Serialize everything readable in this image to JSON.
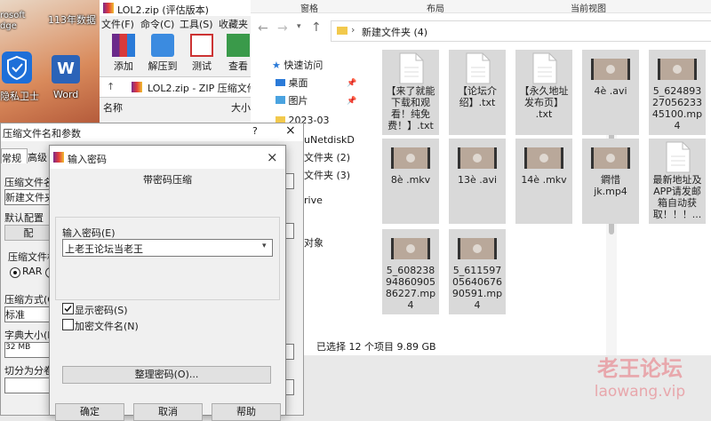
{
  "desktop": {
    "icons": [
      {
        "label": "rosoft\ndge"
      },
      {
        "label": "隐私卫士"
      },
      {
        "label": "Word"
      }
    ],
    "folder_label": "113年数据"
  },
  "zip_window": {
    "title": "LOL2.zip (评估版本)",
    "menu": [
      "文件(F)",
      "命令(C)",
      "工具(S)",
      "收藏夹"
    ],
    "tools": [
      {
        "label": "添加",
        "icon": "add-archive-icon"
      },
      {
        "label": "解压到",
        "icon": "extract-folder-icon"
      },
      {
        "label": "测试",
        "icon": "test-clipboard-icon"
      },
      {
        "label": "查看",
        "icon": "view-book-icon"
      }
    ],
    "path": "LOL2.zip - ZIP 压缩文件,",
    "columns": [
      "名称",
      "大小"
    ]
  },
  "archive_dialog": {
    "title": "压缩文件名和参数",
    "title_help": "?",
    "close": "×",
    "tabs": [
      "常规",
      "高级"
    ],
    "labels": {
      "archive_name": "压缩文件名",
      "archive_name_value": "新建文件夹",
      "default_config": "默认配置",
      "default_btn": "配",
      "format": "压缩文件格",
      "format_rar": "RAR",
      "method": "压缩方式(C",
      "method_value": "标准",
      "dict": "字典大小(I",
      "dict_value": "32 MB",
      "split": "切分为分卷"
    }
  },
  "password_dialog": {
    "title": "输入密码",
    "close": "×",
    "heading": "带密码压缩",
    "input_label": "输入密码(E)",
    "password_value": "上老王论坛当老王",
    "show_password": {
      "label": "显示密码(S)",
      "checked": true
    },
    "encrypt_names": {
      "label": "加密文件名(N)",
      "checked": false
    },
    "organize_button": "整理密码(O)...",
    "buttons": {
      "ok": "确定",
      "cancel": "取消",
      "help": "帮助"
    }
  },
  "explorer": {
    "ribbon": [
      "窗格",
      "布局",
      "当前视图"
    ],
    "breadcrumb": "新建文件夹 (4)",
    "nav": [
      {
        "label": "快速访问",
        "pinned": false
      },
      {
        "label": "桌面",
        "pinned": true
      },
      {
        "label": "图片",
        "pinned": true
      },
      {
        "label": "2023-03",
        "pinned": false
      },
      {
        "label": "uNetdiskD",
        "pinned": false
      },
      {
        "label": "文件夹 (2)",
        "pinned": false
      },
      {
        "label": "文件夹 (3)",
        "pinned": false
      },
      {
        "label": "rive",
        "pinned": false
      },
      {
        "label": "",
        "pinned": false
      },
      {
        "label": "对象",
        "pinned": false
      }
    ],
    "files": [
      {
        "name": "【来了就能下载和观看！纯免费！】.txt",
        "kind": "txt"
      },
      {
        "name": "【论坛介绍】.txt",
        "kind": "txt"
      },
      {
        "name": "【永久地址发布页】.txt",
        "kind": "txt"
      },
      {
        "name": "4è .avi",
        "kind": "video"
      },
      {
        "name": "5_624893270562334 5100.mp4",
        "kind": "video"
      },
      {
        "name": "8è .mkv",
        "kind": "video"
      },
      {
        "name": "13è .avi",
        "kind": "video"
      },
      {
        "name": "14è .mkv",
        "kind": "video"
      },
      {
        "name": "鐧惜jk.mp4",
        "kind": "video"
      },
      {
        "name": "最新地址及APP请发邮箱自动获取！！！...",
        "kind": "txt"
      },
      {
        "name": "5_608238948609058 6227.mp4",
        "kind": "video"
      },
      {
        "name": "5_611597056406769 0591.mp4",
        "kind": "video"
      }
    ],
    "file_display_lines": [
      [
        "【来了就能",
        "下载和观",
        "看！纯免",
        "费！】.txt"
      ],
      [
        "【论坛介",
        "绍】.txt"
      ],
      [
        "【永久地址",
        "发布页】",
        ".txt"
      ],
      [
        "4è .avi"
      ],
      [
        "5_624893",
        "27056233",
        "45100.mp",
        "4"
      ],
      [
        "8è .mkv"
      ],
      [
        "13è .avi"
      ],
      [
        "14è .mkv"
      ],
      [
        "鐧惜",
        "jk.mp4"
      ],
      [
        "最新地址及",
        "APP请发邮",
        "箱自动获",
        "取！！！..."
      ],
      [
        "5_608238",
        "94860905",
        "86227.mp",
        "4"
      ],
      [
        "5_611597",
        "05640676",
        "90591.mp",
        "4"
      ]
    ],
    "status": "已选择 12 个项目  9.89 GB"
  },
  "watermark": {
    "title": "老王论坛",
    "url": "laowang.vip"
  }
}
